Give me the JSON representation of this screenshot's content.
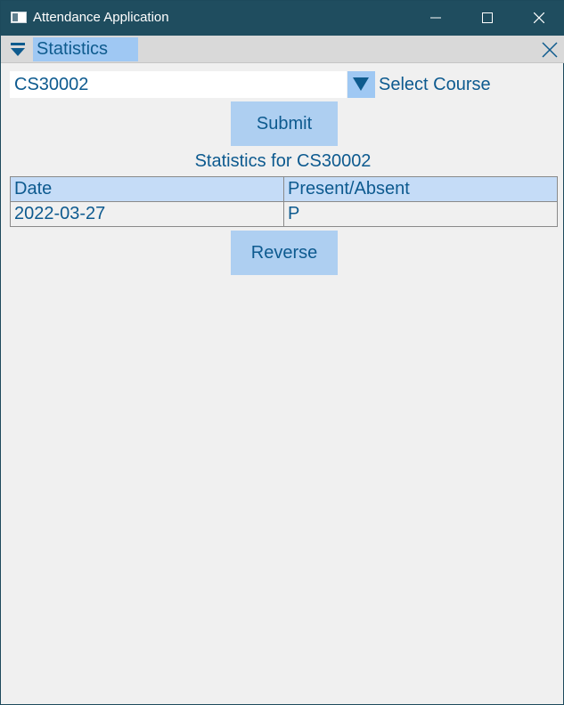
{
  "window": {
    "title": "Attendance Application"
  },
  "panel": {
    "title": "Statistics"
  },
  "course": {
    "value": "CS30002",
    "select_label": "Select Course"
  },
  "buttons": {
    "submit": "Submit",
    "reverse": "Reverse"
  },
  "stats": {
    "title": "Statistics for CS30002",
    "columns": [
      "Date",
      "Present/Absent"
    ],
    "rows": [
      [
        "2022-03-27",
        "P"
      ]
    ]
  }
}
